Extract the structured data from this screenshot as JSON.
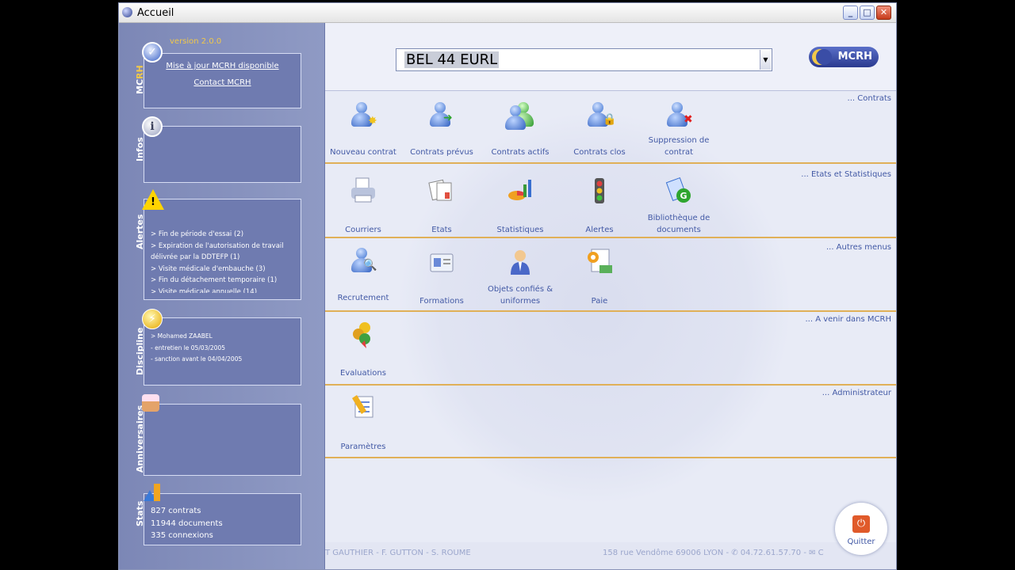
{
  "window": {
    "title": "Accueil"
  },
  "sidebar": {
    "version": "version 2.0.0",
    "mcrh": {
      "label_a": "MC",
      "label_b": "RH",
      "links": [
        "Mise à jour MCRH disponible",
        "Contact MCRH"
      ]
    },
    "infos": {
      "label": "Infos"
    },
    "alertes": {
      "label": "Alertes",
      "items": [
        "> Fin de période d'essai (2)",
        "> Expiration de l'autorisation de travail délivrée par la DDTEFP (1)",
        "> Visite médicale d'embauche (3)",
        "> Fin du détachement temporaire (1)",
        "> Visite médicale annuelle (14)"
      ]
    },
    "discipline": {
      "label": "Discipline",
      "items": [
        "> Mohamed ZAABEL",
        "- entretien le 05/03/2005",
        "- sanction avant le 04/04/2005"
      ]
    },
    "anniversaires": {
      "label": "Anniversaires"
    },
    "stats": {
      "label": "Stats",
      "items": [
        "827 contrats",
        "11944 documents",
        "335 connexions"
      ]
    }
  },
  "header": {
    "company": "BEL 44 EURL",
    "logo": "MCRH"
  },
  "sections": {
    "contrats": {
      "title": "... Contrats",
      "tiles": [
        "Nouveau contrat",
        "Contrats prévus",
        "Contrats actifs",
        "Contrats clos",
        "Suppression de contrat"
      ]
    },
    "etats": {
      "title": "... Etats et Statistiques",
      "tiles": [
        "Courriers",
        "Etats",
        "Statistiques",
        "Alertes",
        "Bibliothèque de documents"
      ]
    },
    "autres": {
      "title": "... Autres menus",
      "tiles": [
        "Recrutement",
        "Formations",
        "Objets confiés & uniformes",
        "Paie"
      ]
    },
    "avenir": {
      "title": "... A venir dans MCRH",
      "tiles": [
        "Evaluations"
      ]
    },
    "admin": {
      "title": "... Administrateur",
      "tiles": [
        "Paramètres"
      ]
    }
  },
  "footer": {
    "left": "T GAUTHIER - F. GUTTON - S. ROUME",
    "right": "158 rue Vendôme 69006 LYON - ✆ 04.72.61.57.70 - ✉ C"
  },
  "quit": {
    "label": "Quitter"
  }
}
